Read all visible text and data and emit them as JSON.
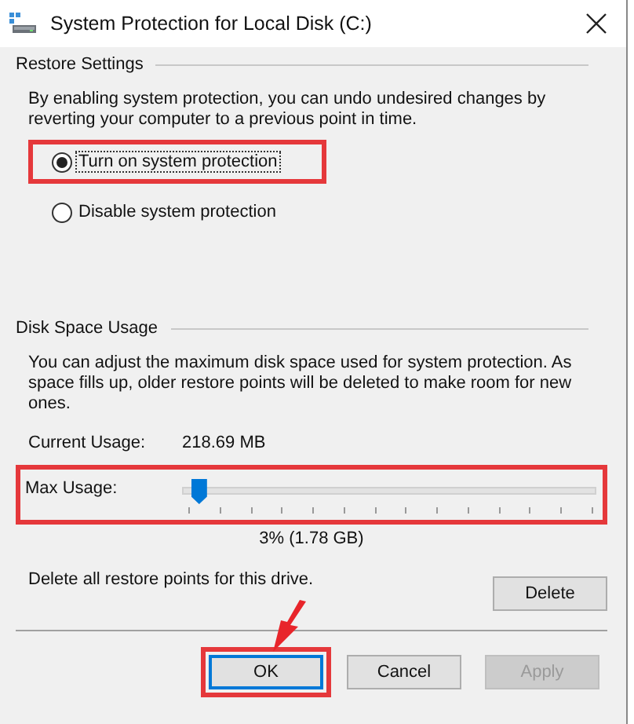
{
  "window": {
    "title": "System Protection for Local Disk (C:)"
  },
  "restore_settings": {
    "heading": "Restore Settings",
    "description": "By enabling system protection, you can undo undesired changes by reverting your computer to a previous point in time.",
    "options": [
      {
        "label": "Turn on system protection",
        "selected": true,
        "highlighted": true
      },
      {
        "label": "Disable system protection",
        "selected": false,
        "highlighted": false
      }
    ]
  },
  "disk_space_usage": {
    "heading": "Disk Space Usage",
    "description": "You can adjust the maximum disk space used for system protection. As space fills up, older restore points will be deleted to make room for new ones.",
    "current_usage_label": "Current Usage:",
    "current_usage_value": "218.69 MB",
    "max_usage": {
      "label": "Max Usage:",
      "level": 0.03,
      "reading": "3% (1.78 GB)",
      "highlighted": true
    },
    "delete_text": "Delete all restore points for this drive.",
    "delete_button": {
      "label": "Delete",
      "disabled": false
    }
  },
  "buttons": [
    {
      "label": "OK",
      "default": true,
      "disabled": false,
      "highlighted": true,
      "arrow": true
    },
    {
      "label": "Cancel",
      "default": false,
      "disabled": false,
      "highlighted": false,
      "arrow": false
    },
    {
      "label": "Apply",
      "default": false,
      "disabled": true,
      "highlighted": false,
      "arrow": false
    }
  ]
}
